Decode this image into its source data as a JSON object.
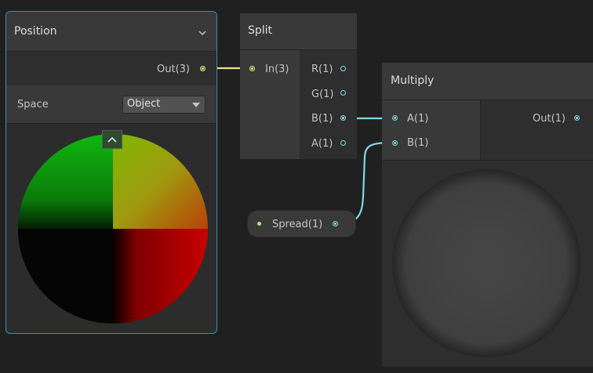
{
  "position_node": {
    "title": "Position",
    "output_label": "Out(3)",
    "space_label": "Space",
    "space_value": "Object"
  },
  "split_node": {
    "title": "Split",
    "input_label": "In(3)",
    "outputs": [
      "R(1)",
      "G(1)",
      "B(1)",
      "A(1)"
    ]
  },
  "multiply_node": {
    "title": "Multiply",
    "inputs": [
      "A(1)",
      "B(1)"
    ],
    "output_label": "Out(1)"
  },
  "property_node": {
    "label": "Spread(1)"
  },
  "colors": {
    "background": "#202020",
    "node_body": "#393939",
    "selection_outline": "#3e8db0",
    "vector3_wire": "#e8e57a",
    "float_wire": "#7fd9e6"
  }
}
